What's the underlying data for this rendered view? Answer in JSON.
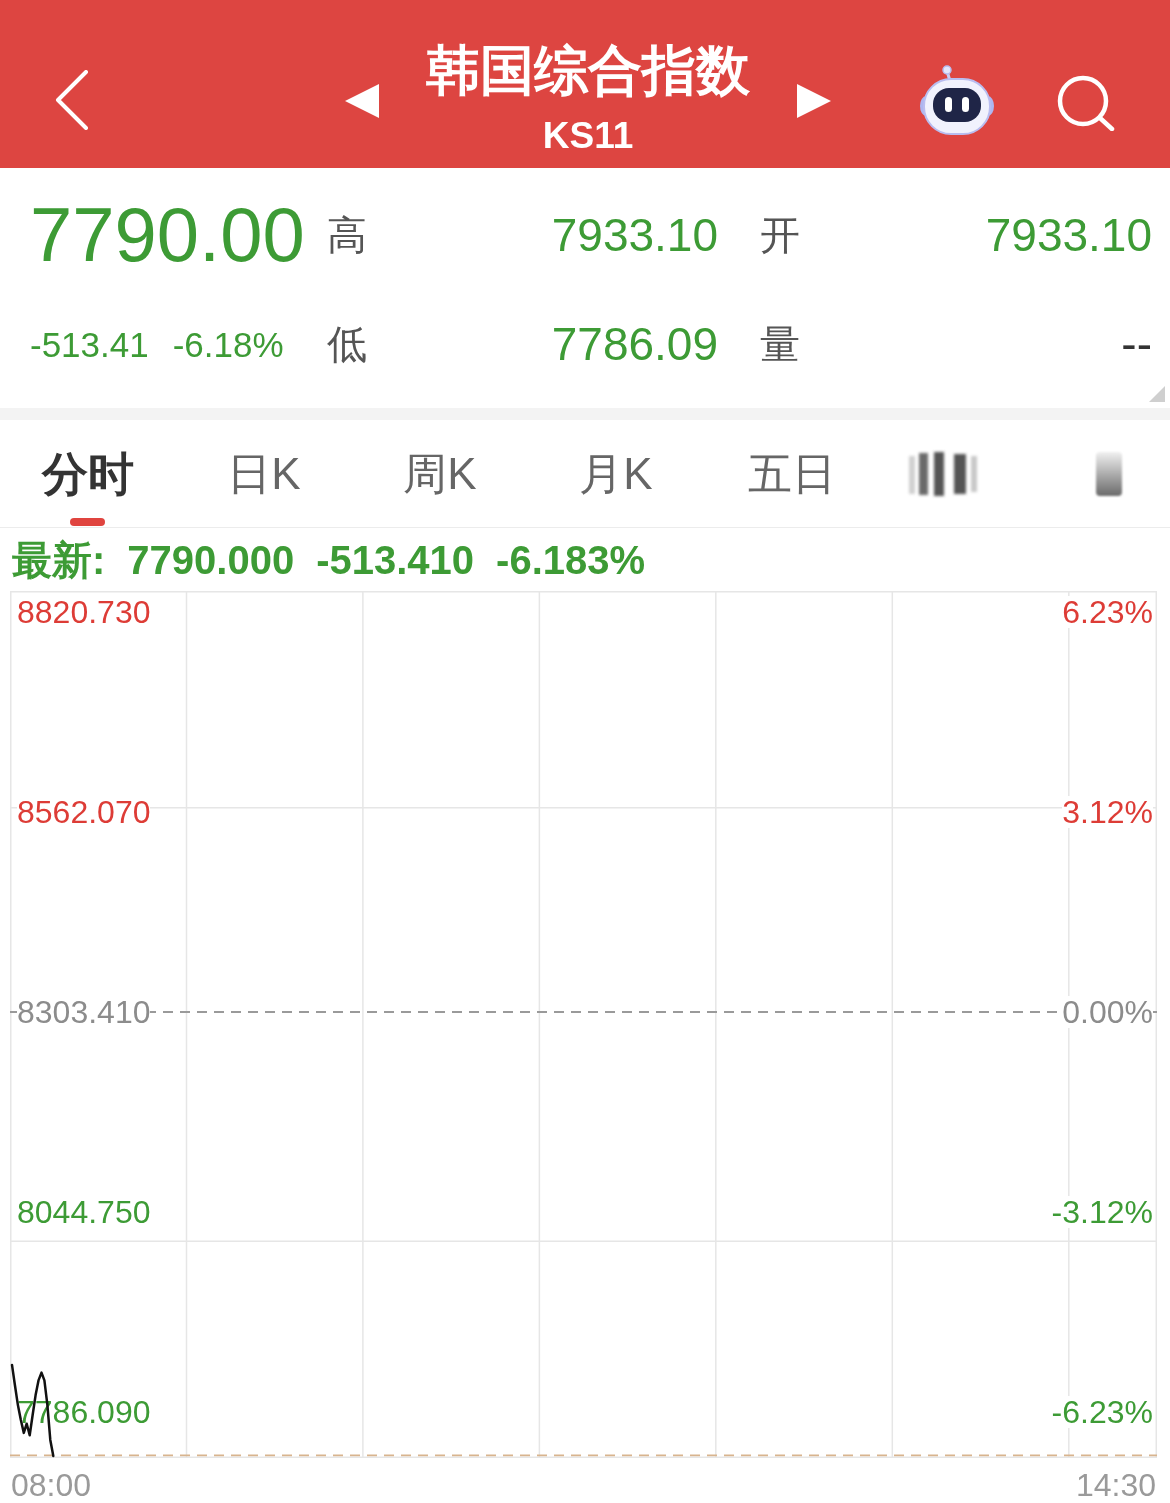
{
  "header": {
    "title": "韩国综合指数",
    "code": "KS11"
  },
  "quote": {
    "price": "7790.00",
    "change": "-513.41",
    "change_percent": "-6.18%",
    "color": "#3d9b35",
    "fields": [
      {
        "label": "高",
        "value": "7933.10",
        "color": "#3d9b35"
      },
      {
        "label": "开",
        "value": "7933.10",
        "color": "#3d9b35"
      },
      {
        "label": "低",
        "value": "7786.09",
        "color": "#3d9b35"
      },
      {
        "label": "量",
        "value": "--",
        "color": "#333333"
      }
    ]
  },
  "tabs": [
    {
      "kind": "text",
      "label": "分时",
      "selected": true
    },
    {
      "kind": "text",
      "label": "日K",
      "selected": false
    },
    {
      "kind": "text",
      "label": "周K",
      "selected": false
    },
    {
      "kind": "text",
      "label": "月K",
      "selected": false
    },
    {
      "kind": "text",
      "label": "五日",
      "selected": false
    },
    {
      "kind": "bars",
      "selected": false
    },
    {
      "kind": "bar",
      "selected": false
    }
  ],
  "latest": {
    "label": "最新:",
    "price": "7790.000",
    "change": "-513.410",
    "percent": "-6.183%",
    "color": "#3d9b35"
  },
  "chart": {
    "right_labels": [
      {
        "text": "6.23%",
        "color": "#dd3c36"
      },
      {
        "text": "3.12%",
        "color": "#dd3c36"
      },
      {
        "text": "0.00%",
        "color": "#8c8c8c"
      },
      {
        "text": "-3.12%",
        "color": "#3d9b35"
      },
      {
        "text": "-6.23%",
        "color": "#3d9b35"
      }
    ],
    "chart_data": {
      "type": "line",
      "x": [
        7.762,
        7.78,
        7.798,
        7.816,
        7.834,
        7.852,
        7.87,
        7.888,
        7.906,
        7.924,
        7.942,
        7.96,
        7.978,
        7.996,
        8.014
      ],
      "series": [
        {
          "color": "#111111",
          "values": [
            7847,
            7821,
            7795,
            7776,
            7759,
            7771,
            7756,
            7782,
            7808,
            7827,
            7837,
            7827,
            7795,
            7750,
            7729
          ]
        }
      ],
      "xlim": [
        7.75,
        14.75
      ],
      "ylim": [
        7726.6,
        8847.9
      ],
      "xticks": [
        {
          "value": 8,
          "label": "08:00"
        },
        {
          "value": 14.5,
          "label": "14:30"
        }
      ],
      "yticks": [
        {
          "value": 8820.73,
          "label": "8820.730"
        },
        {
          "value": 8562.07,
          "label": "8562.070"
        },
        {
          "value": 8303.41,
          "label": "8303.410"
        },
        {
          "value": 8044.75,
          "label": "8044.750"
        },
        {
          "value": 7786.09,
          "label": "7786.090"
        }
      ],
      "ref_lines": [
        {
          "axis": "y",
          "value": 8303.41,
          "color": "#9a9a9a"
        },
        {
          "axis": "y",
          "value": 7730,
          "color": "#d8b48e"
        }
      ]
    }
  }
}
